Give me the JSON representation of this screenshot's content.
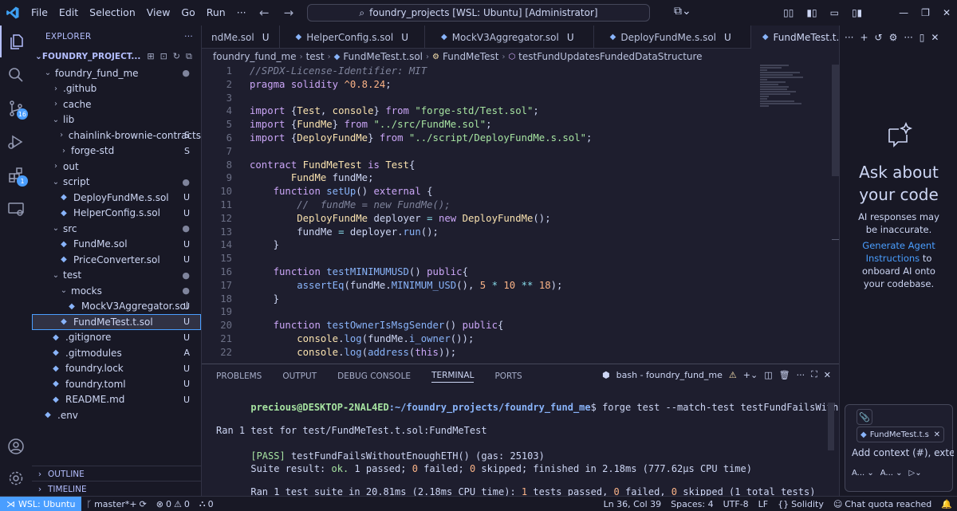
{
  "window": {
    "menu": [
      "File",
      "Edit",
      "Selection",
      "View",
      "Go",
      "Run",
      "···"
    ],
    "search": "foundry_projects [WSL: Ubuntu] [Administrator]"
  },
  "sidebar": {
    "title": "EXPLORER",
    "root": "FOUNDRY_PROJECT...",
    "items": [
      {
        "label": "foundry_fund_me",
        "indent": 1,
        "type": "folder-open",
        "status": "●"
      },
      {
        "label": ".github",
        "indent": 2,
        "type": "folder",
        "status": ""
      },
      {
        "label": "cache",
        "indent": 2,
        "type": "folder",
        "status": ""
      },
      {
        "label": "lib",
        "indent": 2,
        "type": "folder-open",
        "status": ""
      },
      {
        "label": "chainlink-brownie-contracts",
        "indent": 3,
        "type": "folder",
        "status": "S"
      },
      {
        "label": "forge-std",
        "indent": 3,
        "type": "folder",
        "status": "S"
      },
      {
        "label": "out",
        "indent": 2,
        "type": "folder",
        "status": ""
      },
      {
        "label": "script",
        "indent": 2,
        "type": "folder-open",
        "status": "●"
      },
      {
        "label": "DeployFundMe.s.sol",
        "indent": 3,
        "type": "file",
        "status": "U"
      },
      {
        "label": "HelperConfig.s.sol",
        "indent": 3,
        "type": "file",
        "status": "U"
      },
      {
        "label": "src",
        "indent": 2,
        "type": "folder-open",
        "status": "●"
      },
      {
        "label": "FundMe.sol",
        "indent": 3,
        "type": "file",
        "status": "U"
      },
      {
        "label": "PriceConverter.sol",
        "indent": 3,
        "type": "file",
        "status": "U"
      },
      {
        "label": "test",
        "indent": 2,
        "type": "folder-open",
        "status": "●"
      },
      {
        "label": "mocks",
        "indent": 3,
        "type": "folder-open",
        "status": "●"
      },
      {
        "label": "MockV3Aggregator.sol",
        "indent": 4,
        "type": "file",
        "status": "U"
      },
      {
        "label": "FundMeTest.t.sol",
        "indent": 3,
        "type": "file",
        "status": "U",
        "selected": true
      },
      {
        "label": ".gitignore",
        "indent": 2,
        "type": "file",
        "status": "U"
      },
      {
        "label": ".gitmodules",
        "indent": 2,
        "type": "file",
        "status": "A"
      },
      {
        "label": "foundry.lock",
        "indent": 2,
        "type": "file",
        "status": "U"
      },
      {
        "label": "foundry.toml",
        "indent": 2,
        "type": "file",
        "status": "U"
      },
      {
        "label": "README.md",
        "indent": 2,
        "type": "file",
        "status": "U"
      },
      {
        "label": ".env",
        "indent": 1,
        "type": "file",
        "status": ""
      }
    ],
    "outline": "OUTLINE",
    "timeline": "TIMELINE"
  },
  "activity": {
    "scm_badge": "16",
    "ext_badge": "1"
  },
  "tabs": [
    {
      "label": "ndMe.sol",
      "mod": "U",
      "active": false
    },
    {
      "label": "HelperConfig.s.sol",
      "mod": "U",
      "active": false
    },
    {
      "label": "MockV3Aggregator.sol",
      "mod": "U",
      "active": false
    },
    {
      "label": "DeployFundMe.s.sol",
      "mod": "U",
      "active": false
    },
    {
      "label": "FundMeTest.t.sol",
      "mod": "U",
      "active": true
    }
  ],
  "breadcrumb": [
    "foundry_fund_me",
    "test",
    "FundMeTest.t.sol",
    "FundMeTest",
    "testFundUpdatesFundedDataStructure"
  ],
  "code": [
    {
      "n": "1",
      "t": [
        [
          "com",
          "//SPDX-License-Identifier: MIT"
        ]
      ]
    },
    {
      "n": "2",
      "t": [
        [
          "kw",
          "pragma"
        ],
        [
          "var",
          " "
        ],
        [
          "kw",
          "solidity"
        ],
        [
          "var",
          " "
        ],
        [
          "num",
          "^0.8.24"
        ],
        [
          "var",
          ";"
        ]
      ]
    },
    {
      "n": "3",
      "t": []
    },
    {
      "n": "4",
      "t": [
        [
          "kw",
          "import"
        ],
        [
          "var",
          " {"
        ],
        [
          "type",
          "Test"
        ],
        [
          "var",
          ", "
        ],
        [
          "type",
          "console"
        ],
        [
          "var",
          "} "
        ],
        [
          "kw",
          "from"
        ],
        [
          "var",
          " "
        ],
        [
          "str",
          "\"forge-std/Test.sol\""
        ],
        [
          "var",
          ";"
        ]
      ]
    },
    {
      "n": "5",
      "t": [
        [
          "kw",
          "import"
        ],
        [
          "var",
          " {"
        ],
        [
          "type",
          "FundMe"
        ],
        [
          "var",
          "} "
        ],
        [
          "kw",
          "from"
        ],
        [
          "var",
          " "
        ],
        [
          "str",
          "\"../src/FundMe.sol\""
        ],
        [
          "var",
          ";"
        ]
      ]
    },
    {
      "n": "6",
      "t": [
        [
          "kw",
          "import"
        ],
        [
          "var",
          " {"
        ],
        [
          "type",
          "DeployFundMe"
        ],
        [
          "var",
          "} "
        ],
        [
          "kw",
          "from"
        ],
        [
          "var",
          " "
        ],
        [
          "str",
          "\"../script/DeployFundMe.s.sol\""
        ],
        [
          "var",
          ";"
        ]
      ]
    },
    {
      "n": "7",
      "t": []
    },
    {
      "n": "8",
      "t": [
        [
          "kw",
          "contract"
        ],
        [
          "var",
          " "
        ],
        [
          "type",
          "FundMeTest"
        ],
        [
          "var",
          " "
        ],
        [
          "kw",
          "is"
        ],
        [
          "var",
          " "
        ],
        [
          "type",
          "Test"
        ],
        [
          "var",
          "{"
        ]
      ]
    },
    {
      "n": "9",
      "t": [
        [
          "var",
          "       "
        ],
        [
          "type",
          "FundMe"
        ],
        [
          "var",
          " fundMe;"
        ]
      ]
    },
    {
      "n": "10",
      "t": [
        [
          "var",
          "    "
        ],
        [
          "kw",
          "function"
        ],
        [
          "var",
          " "
        ],
        [
          "fn",
          "setUp"
        ],
        [
          "var",
          "() "
        ],
        [
          "kw",
          "external"
        ],
        [
          "var",
          " {"
        ]
      ]
    },
    {
      "n": "11",
      "t": [
        [
          "var",
          "        "
        ],
        [
          "com",
          "//  fundMe = new FundMe();"
        ]
      ]
    },
    {
      "n": "12",
      "t": [
        [
          "var",
          "        "
        ],
        [
          "type",
          "DeployFundMe"
        ],
        [
          "var",
          " deployer "
        ],
        [
          "op",
          "="
        ],
        [
          "var",
          " "
        ],
        [
          "kw",
          "new"
        ],
        [
          "var",
          " "
        ],
        [
          "type",
          "DeployFundMe"
        ],
        [
          "var",
          "();"
        ]
      ]
    },
    {
      "n": "13",
      "t": [
        [
          "var",
          "        fundMe "
        ],
        [
          "op",
          "="
        ],
        [
          "var",
          " deployer."
        ],
        [
          "fn",
          "run"
        ],
        [
          "var",
          "();"
        ]
      ]
    },
    {
      "n": "14",
      "t": [
        [
          "var",
          "    }"
        ]
      ]
    },
    {
      "n": "15",
      "t": []
    },
    {
      "n": "16",
      "t": [
        [
          "var",
          "    "
        ],
        [
          "kw",
          "function"
        ],
        [
          "var",
          " "
        ],
        [
          "fn",
          "testMINIMUMUSD"
        ],
        [
          "var",
          "() "
        ],
        [
          "kw",
          "public"
        ],
        [
          "var",
          "{"
        ]
      ]
    },
    {
      "n": "17",
      "t": [
        [
          "var",
          "        "
        ],
        [
          "fn",
          "assertEq"
        ],
        [
          "var",
          "(fundMe."
        ],
        [
          "fn",
          "MINIMUM_USD"
        ],
        [
          "var",
          "(), "
        ],
        [
          "num",
          "5"
        ],
        [
          "var",
          " "
        ],
        [
          "op",
          "*"
        ],
        [
          "var",
          " "
        ],
        [
          "num",
          "10"
        ],
        [
          "var",
          " "
        ],
        [
          "op",
          "**"
        ],
        [
          "var",
          " "
        ],
        [
          "num",
          "18"
        ],
        [
          "var",
          ");"
        ]
      ]
    },
    {
      "n": "18",
      "t": [
        [
          "var",
          "    }"
        ]
      ]
    },
    {
      "n": "19",
      "t": []
    },
    {
      "n": "20",
      "t": [
        [
          "var",
          "    "
        ],
        [
          "kw",
          "function"
        ],
        [
          "var",
          " "
        ],
        [
          "fn",
          "testOwnerIsMsgSender"
        ],
        [
          "var",
          "() "
        ],
        [
          "kw",
          "public"
        ],
        [
          "var",
          "{"
        ]
      ]
    },
    {
      "n": "21",
      "t": [
        [
          "var",
          "        "
        ],
        [
          "type",
          "console"
        ],
        [
          "var",
          "."
        ],
        [
          "fn",
          "log"
        ],
        [
          "var",
          "(fundMe."
        ],
        [
          "fn",
          "i_owner"
        ],
        [
          "var",
          "());"
        ]
      ]
    },
    {
      "n": "22",
      "t": [
        [
          "var",
          "        "
        ],
        [
          "type",
          "console"
        ],
        [
          "var",
          "."
        ],
        [
          "fn",
          "log"
        ],
        [
          "var",
          "("
        ],
        [
          "fn",
          "address"
        ],
        [
          "var",
          "("
        ],
        [
          "kw",
          "this"
        ],
        [
          "var",
          "));"
        ]
      ]
    }
  ],
  "panel": {
    "tabs": [
      "PROBLEMS",
      "OUTPUT",
      "DEBUG CONSOLE",
      "TERMINAL",
      "PORTS"
    ],
    "active_tab": "TERMINAL",
    "shell": "bash - foundry_fund_me"
  },
  "terminal": {
    "prompt_user": "precious@DESKTOP-2NAL4ED",
    "prompt_path": ":~/foundry_projects/foundry_fund_me",
    "command": "$ forge test --match-test testFundFailsWithoutEnoughETH",
    "ran1": "Ran 1 test for test/FundMeTest.t.sol:FundMeTest",
    "pass_tag": "[PASS]",
    "pass_rest": " testFundFailsWithoutEnoughETH() (gas: 25103)",
    "suite_a": "Suite result: ",
    "suite_ok": "ok.",
    "suite_b": " 1 passed; ",
    "suite_c": "0",
    "suite_d": " failed; ",
    "suite_e": "0",
    "suite_f": " skipped; finished in 2.18ms (777.62µs CPU time)",
    "ran2_a": "Ran 1 test suite in 20.81ms (2.18ms CPU time): ",
    "ran2_b": "1",
    "ran2_c": " tests passed, ",
    "ran2_d": "0",
    "ran2_e": " failed, ",
    "ran2_f": "0",
    "ran2_g": " skipped (1 total tests)",
    "prompt_end": "$"
  },
  "chat": {
    "title_l1": "Ask about",
    "title_l2": "your code",
    "warn_l1": "AI responses may",
    "warn_l2": "be inaccurate.",
    "link_l1": "Generate Agent",
    "link_l2": "Instructions",
    "after_link": " to",
    "rest_l1": "onboard AI onto",
    "rest_l2": "your codebase.",
    "chip": "FundMeTest.t.s",
    "context_placeholder": "Add context (#), exter",
    "mode1": "A...",
    "mode2": "A..."
  },
  "statusbar": {
    "remote": "WSL: Ubuntu",
    "branch": "master*+",
    "errors": "0",
    "warnings": "0",
    "ports": "0",
    "position": "Ln 36, Col 39",
    "spaces": "Spaces: 4",
    "encoding": "UTF-8",
    "eol": "LF",
    "language": "Solidity",
    "quota": "Chat quota reached"
  },
  "colors": {
    "accent": "#4a9eff",
    "background": "#1e1e2e",
    "sidebar": "#181825"
  }
}
